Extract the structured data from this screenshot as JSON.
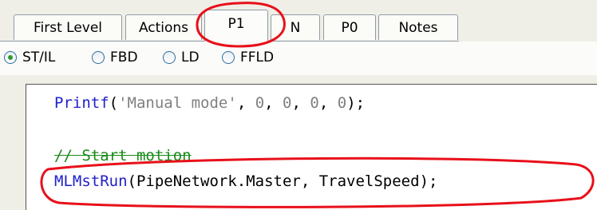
{
  "tabs": [
    {
      "label": "First Level",
      "active": false
    },
    {
      "label": "Actions",
      "active": false
    },
    {
      "label": "P1",
      "active": true
    },
    {
      "label": "N",
      "active": false
    },
    {
      "label": "P0",
      "active": false
    },
    {
      "label": "Notes",
      "active": false
    }
  ],
  "languages": [
    {
      "label": "ST/IL",
      "checked": true
    },
    {
      "label": "FBD",
      "checked": false
    },
    {
      "label": "LD",
      "checked": false
    },
    {
      "label": "FFLD",
      "checked": false
    }
  ],
  "code": {
    "line1": {
      "fn": "Printf",
      "open": "(",
      "str": "'Manual mode'",
      "sep1": ", ",
      "n1": "0",
      "sep2": ", ",
      "n2": "0",
      "sep3": ", ",
      "n3": "0",
      "sep4": ", ",
      "n4": "0",
      "close": ");"
    },
    "comment": "// Start motion",
    "line3": {
      "fn": "MLMstRun",
      "args": "(PipeNetwork.Master, TravelSpeed);"
    }
  },
  "colors": {
    "annotation": "#e8101a",
    "function": "#2020c8",
    "comment": "#1a8a1a",
    "literal": "#808080"
  }
}
